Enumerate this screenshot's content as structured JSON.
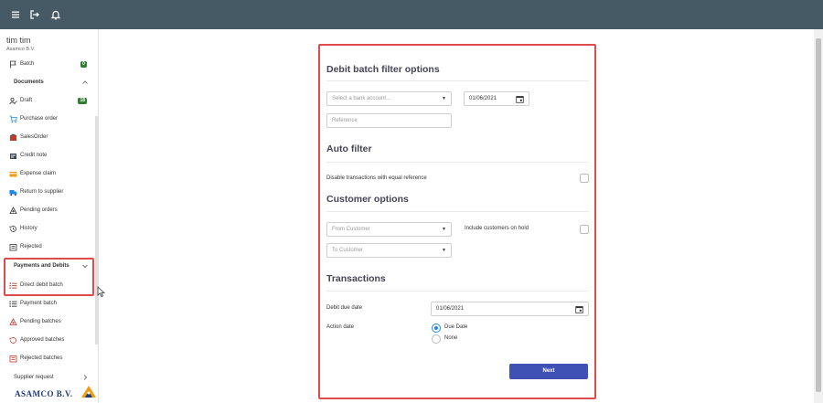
{
  "topbar": {
    "icons": [
      "menu-icon",
      "logout-icon",
      "bell-icon"
    ]
  },
  "user": {
    "name": "tim tim",
    "company": "Asamco B.V."
  },
  "sidebar": {
    "items": [
      {
        "label": "Batch",
        "icon": "flag-icon",
        "badge": "0"
      },
      {
        "label": "Documents",
        "section": true
      },
      {
        "label": "Draft",
        "icon": "user-edit-icon",
        "badge": "18"
      },
      {
        "label": "Purchase order",
        "icon": "cart-icon"
      },
      {
        "label": "SalesOrder",
        "icon": "sales-order-icon"
      },
      {
        "label": "Credit note",
        "icon": "credit-note-icon"
      },
      {
        "label": "Expense claim",
        "icon": "expense-icon"
      },
      {
        "label": "Return to supplier",
        "icon": "truck-icon"
      },
      {
        "label": "Pending orders",
        "icon": "pending-icon"
      },
      {
        "label": "History",
        "icon": "history-icon"
      },
      {
        "label": "Rejected",
        "icon": "rejected-icon"
      },
      {
        "label": "Payments and Debits",
        "section": true
      },
      {
        "label": "Direct debit batch",
        "icon": "list-icon"
      },
      {
        "label": "Payment batch",
        "icon": "list-icon"
      },
      {
        "label": "Pending batches",
        "icon": "pending-batches-icon"
      },
      {
        "label": "Approved batches",
        "icon": "approved-icon"
      },
      {
        "label": "Rejected batches",
        "icon": "rejected-batches-icon"
      },
      {
        "label": "Supplier request",
        "section": true
      }
    ],
    "logo_text": "ASAMCO B.V."
  },
  "form": {
    "filter_title": "Debit batch filter options",
    "bank_account_placeholder": "Select a bank account...",
    "date_value": "01/06/2021",
    "reference_placeholder": "Reference",
    "auto_filter_title": "Auto filter",
    "disable_equal_ref_label": "Disable transactions with equal reference",
    "customer_options_title": "Customer options",
    "from_customer_placeholder": "From Customer",
    "include_on_hold_label": "Include customers on hold",
    "to_customer_placeholder": "To Customer",
    "transactions_title": "Transactions",
    "debit_due_date_label": "Debit due date",
    "debit_due_date_value": "01/06/2021",
    "action_date_label": "Action date",
    "due_date_option": "Due Date",
    "none_option": "None",
    "next_label": "Next"
  },
  "colors": {
    "topbar": "#455a64",
    "highlight": "#e04b4b",
    "primary": "#3f51b5",
    "badge": "#2e7d32"
  }
}
